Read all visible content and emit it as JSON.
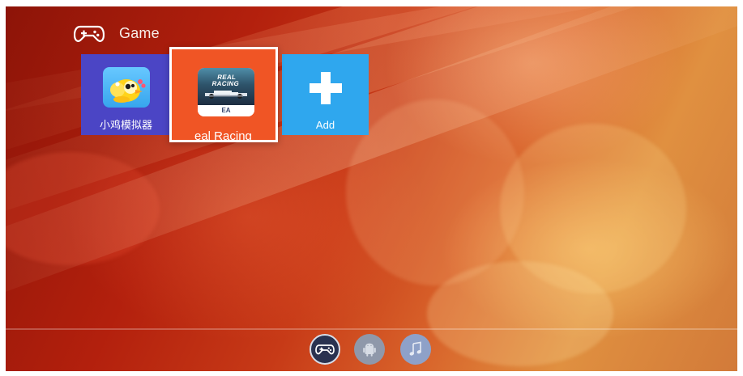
{
  "header": {
    "icon": "gamepad-icon",
    "title": "Game"
  },
  "tiles": [
    {
      "label": "小鸡模拟器",
      "icon": "chicken-emulator-icon",
      "background": "#4b45c5"
    },
    {
      "label": "eal Racing",
      "icon": "real-racing-icon",
      "background": "#f05525",
      "selected": true,
      "art_title": "REAL RACING",
      "art_brand": "EA"
    },
    {
      "label": "Add",
      "icon": "plus-icon",
      "background": "#2fa7ee"
    }
  ],
  "dock": {
    "items": [
      {
        "icon": "gamepad-icon",
        "active": true
      },
      {
        "icon": "android-icon",
        "active": false
      },
      {
        "icon": "music-note-icon",
        "active": false
      }
    ]
  },
  "theme": {
    "background_primary": "#b3200d",
    "background_secondary": "#d8622a",
    "highlight": "#ffffff"
  }
}
